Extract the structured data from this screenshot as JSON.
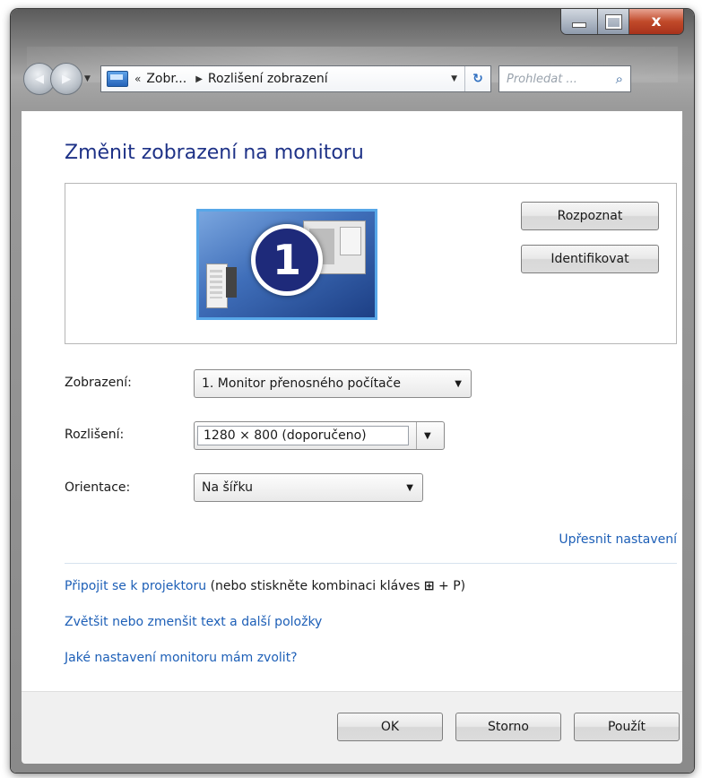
{
  "window": {
    "controls": {
      "close_glyph": "x"
    }
  },
  "navbar": {
    "back_glyph": "◀",
    "forward_glyph": "▶",
    "address": {
      "overflow_glyph": "«",
      "crumb1": "Zobr...",
      "separator_glyph": "▶",
      "crumb2": "Rozlišení zobrazení",
      "dropdown_glyph": "▼",
      "refresh_glyph": "↻"
    },
    "search_placeholder": "Prohledat ...",
    "search_glyph": "⌕"
  },
  "main": {
    "title": "Změnit zobrazení na monitoru",
    "monitor_number": "1",
    "detect_label": "Rozpoznat",
    "identify_label": "Identifikovat",
    "fields": {
      "display_label": "Zobrazení:",
      "display_value": "1. Monitor přenosného počítače",
      "resolution_label": "Rozlišení:",
      "resolution_value": "1280 × 800 (doporučeno)",
      "orientation_label": "Orientace:",
      "orientation_value": "Na šířku"
    },
    "advanced_link": "Upřesnit nastavení",
    "projector_link": "Připojit se k projektoru",
    "projector_hint_prefix": " (nebo stiskněte kombinaci kláves ",
    "projector_hint_winkey": "⊞",
    "projector_hint_suffix": " + P)",
    "text_size_link": "Zvětšit nebo zmenšit text a další položky",
    "which_settings_link": "Jaké nastavení monitoru mám zvolit?"
  },
  "footer": {
    "ok_label": "OK",
    "cancel_label": "Storno",
    "apply_label": "Použít"
  }
}
